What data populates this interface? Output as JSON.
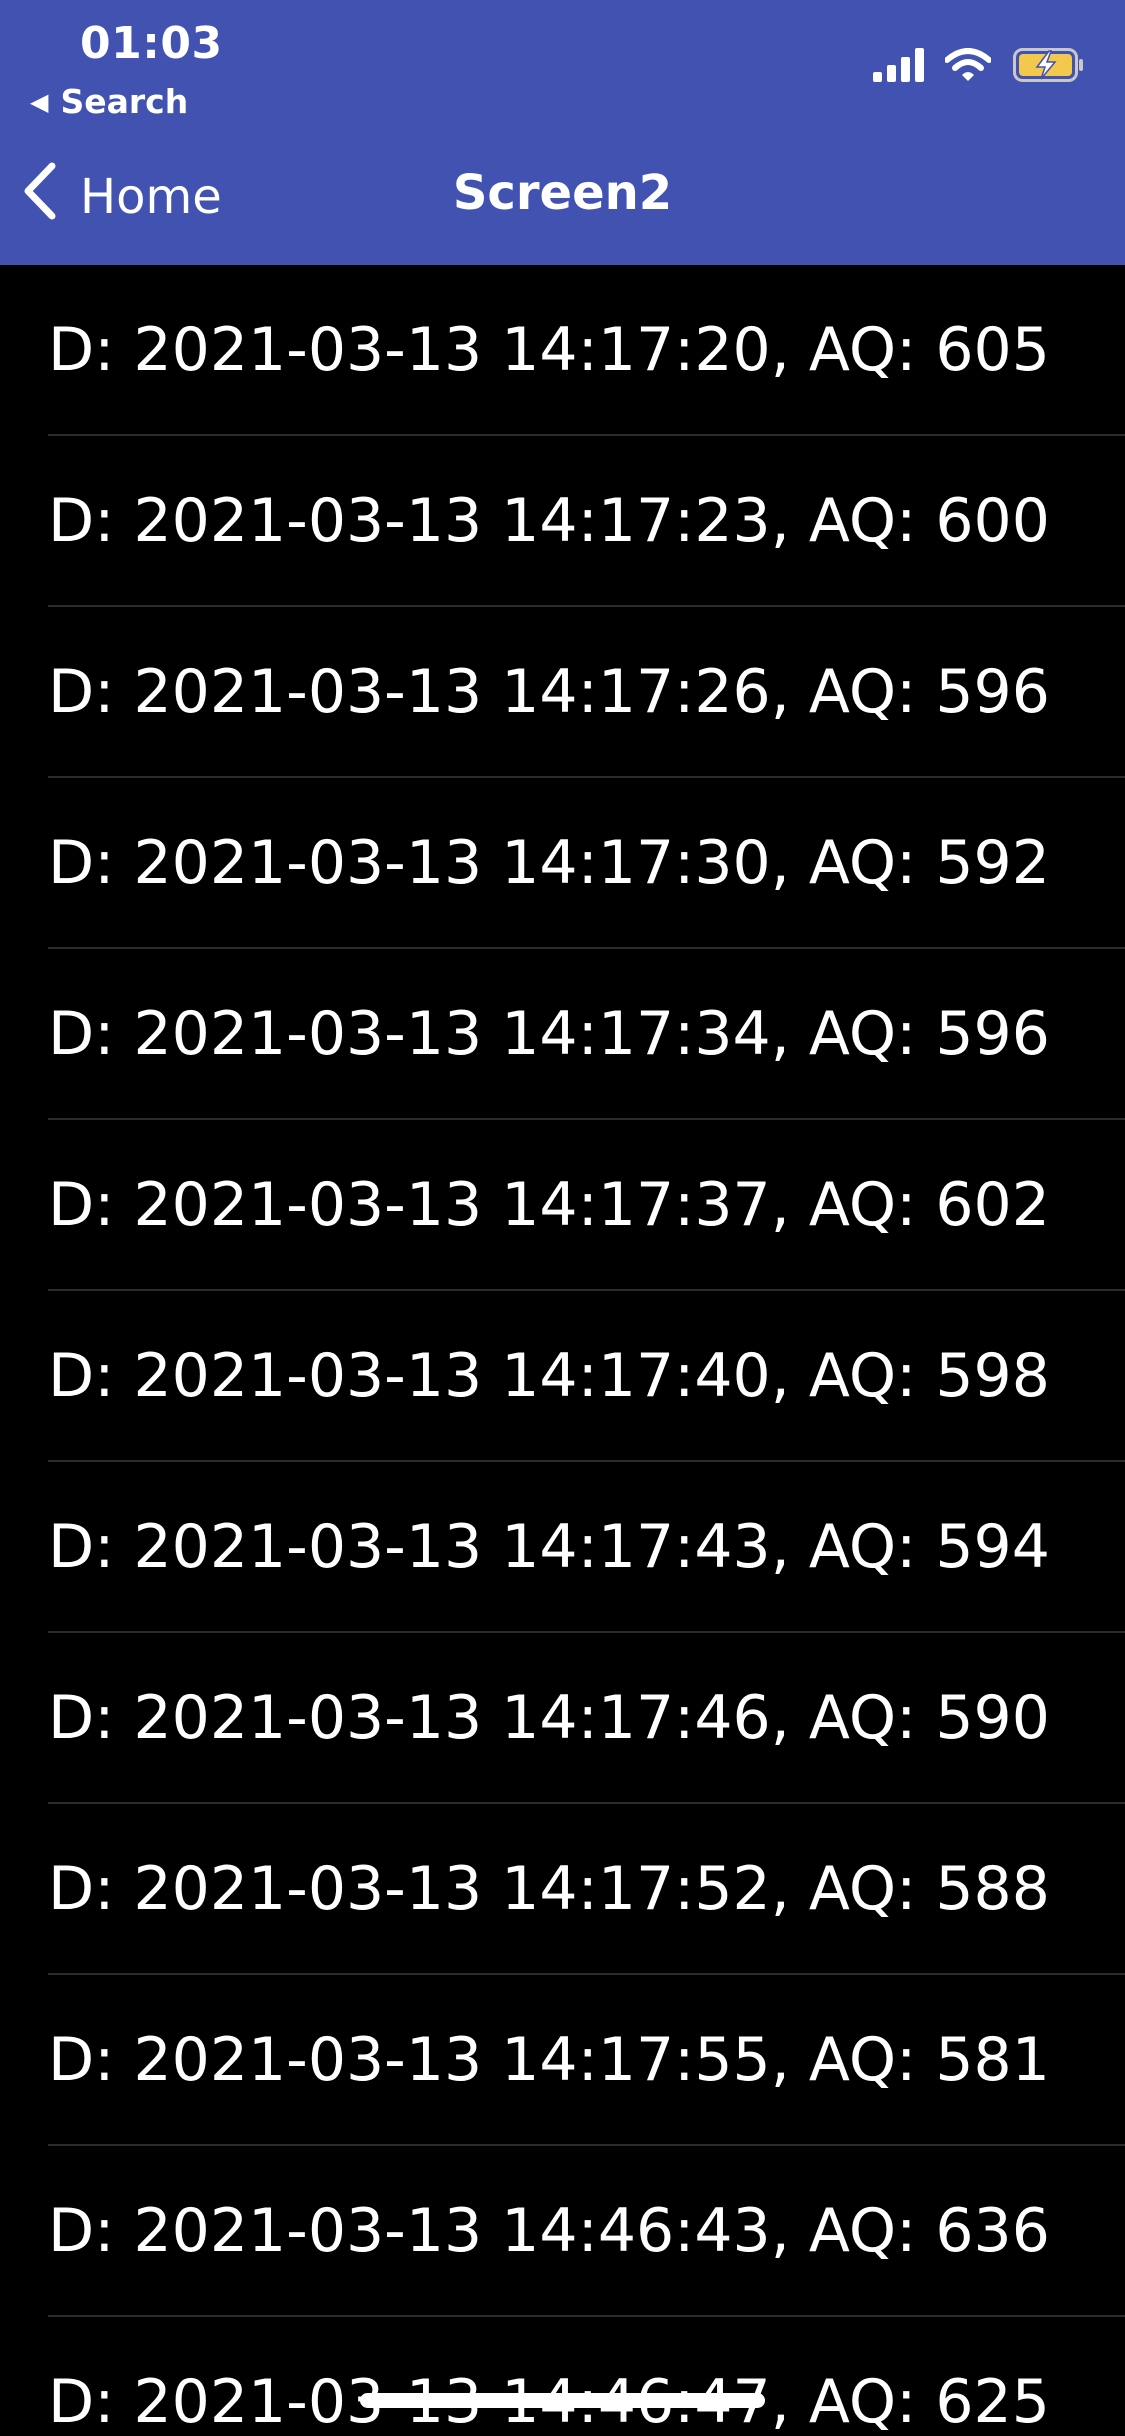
{
  "status_bar": {
    "time": "01:03",
    "back_app_label": "Search",
    "battery_color": "#F2C94C"
  },
  "nav": {
    "back_label": "Home",
    "title": "Screen2"
  },
  "colors": {
    "header_bg": "#4152B0",
    "list_bg": "#000000",
    "text": "#FFFFFF"
  },
  "list": {
    "items": [
      "D: 2021-03-13 14:17:20, AQ: 605",
      "D: 2021-03-13 14:17:23, AQ: 600",
      "D: 2021-03-13 14:17:26, AQ: 596",
      "D: 2021-03-13 14:17:30, AQ: 592",
      "D: 2021-03-13 14:17:34, AQ: 596",
      "D: 2021-03-13 14:17:37, AQ: 602",
      "D: 2021-03-13 14:17:40, AQ: 598",
      "D: 2021-03-13 14:17:43, AQ: 594",
      "D: 2021-03-13 14:17:46, AQ: 590",
      "D: 2021-03-13 14:17:52, AQ: 588",
      "D: 2021-03-13 14:17:55, AQ: 581",
      "D: 2021-03-13 14:46:43, AQ: 636",
      "D: 2021-03-13 14:46:47, AQ: 625"
    ]
  },
  "icons": {
    "signal": "cellular-signal-icon",
    "wifi": "wifi-icon",
    "battery": "battery-charging-icon",
    "back": "chevron-left-icon"
  }
}
